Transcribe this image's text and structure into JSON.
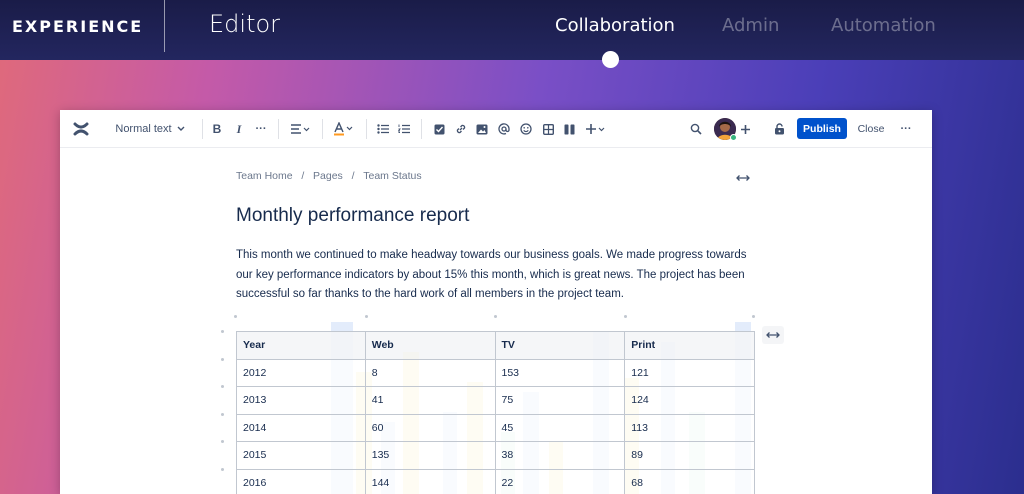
{
  "header": {
    "brand": "EXPERIENCE",
    "product": "Editor",
    "nav": [
      {
        "label": "Collaboration",
        "active": true
      },
      {
        "label": "Admin",
        "active": false
      },
      {
        "label": "Automation",
        "active": false
      }
    ]
  },
  "toolbar": {
    "text_style": "Normal text",
    "publish_label": "Publish",
    "close_label": "Close",
    "icons": [
      "confluence-logo-icon",
      "bold-icon",
      "italic-icon",
      "more-formatting-icon",
      "align-icon",
      "text-color-icon",
      "bullet-list-icon",
      "numbered-list-icon",
      "action-item-icon",
      "link-icon",
      "image-icon",
      "mention-icon",
      "emoji-icon",
      "table-icon",
      "layout-icon",
      "insert-icon",
      "search-icon",
      "add-collaborator-icon",
      "restrictions-icon",
      "more-icon"
    ]
  },
  "page": {
    "breadcrumb": [
      "Team Home",
      "Pages",
      "Team Status"
    ],
    "title": "Monthly performance report",
    "paragraph": "This month we continued to make headway towards our business goals. We made progress towards our key performance indicators by about 15% this month, which is great news. The project has been successful so far thanks to the hard work of all members in the project team."
  },
  "table": {
    "headers": [
      "Year",
      "Web",
      "TV",
      "Print"
    ],
    "rows": [
      [
        "2012",
        "8",
        "153",
        "121"
      ],
      [
        "2013",
        "41",
        "75",
        "124"
      ],
      [
        "2014",
        "60",
        "45",
        "113"
      ],
      [
        "2015",
        "135",
        "38",
        "89"
      ],
      [
        "2016",
        "144",
        "22",
        "68"
      ]
    ]
  },
  "colors": {
    "accent": "#0052cc",
    "topbar": "#1a1c48",
    "text": "#172b4d",
    "muted": "#6b778c"
  }
}
